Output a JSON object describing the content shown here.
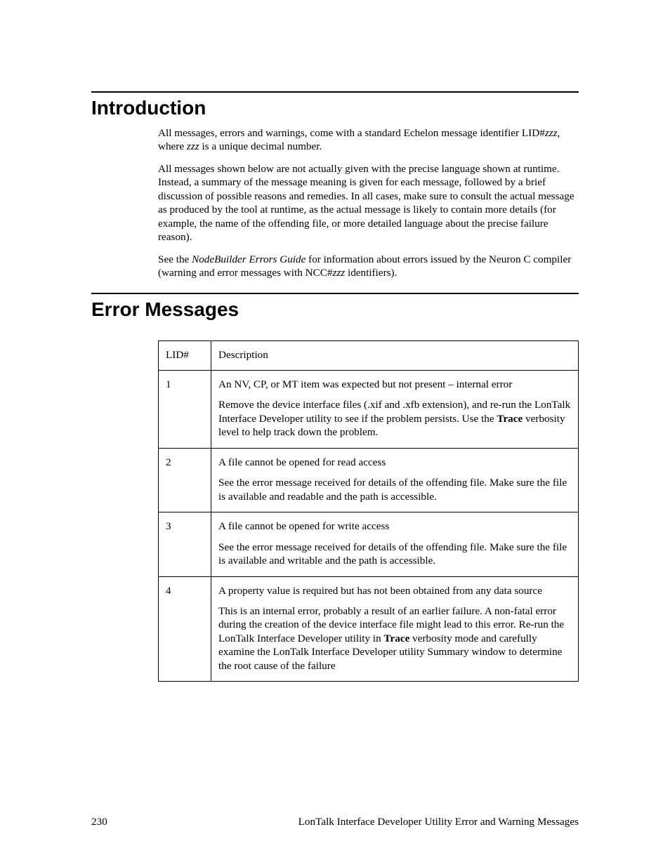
{
  "sections": {
    "intro_heading": "Introduction",
    "errors_heading": "Error Messages"
  },
  "intro": {
    "p1_a": "All messages, errors and warnings, come with a standard Echelon message identifier LID#",
    "p1_b": "zzz",
    "p1_c": ", where ",
    "p1_d": "zzz",
    "p1_e": " is a unique decimal number.",
    "p2": "All messages shown below are not actually given with the precise language shown at runtime. Instead, a summary of the message meaning is given for each message, followed by a brief discussion of possible reasons and remedies. In all cases, make sure to consult the actual message as produced by the tool at runtime, as the actual message is likely to contain more details (for example, the name of the offending file, or more detailed language about the precise failure reason).",
    "p3_a": "See the ",
    "p3_b": "NodeBuilder Errors Guide",
    "p3_c": " for information about errors issued by the Neuron C compiler (warning and error messages with NCC#",
    "p3_d": "zzz",
    "p3_e": " identifiers)."
  },
  "table": {
    "header_lid": "LID#",
    "header_desc": "Description",
    "rows": [
      {
        "lid": "1",
        "title": "An NV, CP, or MT item was expected but not present – internal error",
        "body_a": "Remove the device interface files (.xif and .xfb extension), and re-run the LonTalk Interface Developer utility to see if the problem persists. Use the ",
        "bold": "Trace",
        "body_b": " verbosity level to help track down the problem."
      },
      {
        "lid": "2",
        "title": "A file cannot be opened for read access",
        "body_a": "See the error message received for details of the offending file. Make sure the file is available and readable and the path is accessible.",
        "bold": "",
        "body_b": ""
      },
      {
        "lid": "3",
        "title": "A file cannot be opened for write access",
        "body_a": "See the error message received for details of the offending file. Make sure the file is available and writable and the path is accessible.",
        "bold": "",
        "body_b": ""
      },
      {
        "lid": "4",
        "title": "A property value is required but has not been obtained from any data source",
        "body_a": "This is an internal error, probably a result of an earlier failure. A non-fatal error during the creation of the device interface file might lead to this error. Re-run the LonTalk Interface Developer utility in ",
        "bold": "Trace",
        "body_b": " verbosity mode and carefully examine the LonTalk Interface Developer utility Summary window to determine the root cause of the failure"
      }
    ]
  },
  "footer": {
    "page": "230",
    "title": "LonTalk Interface Developer Utility Error and Warning Messages"
  }
}
